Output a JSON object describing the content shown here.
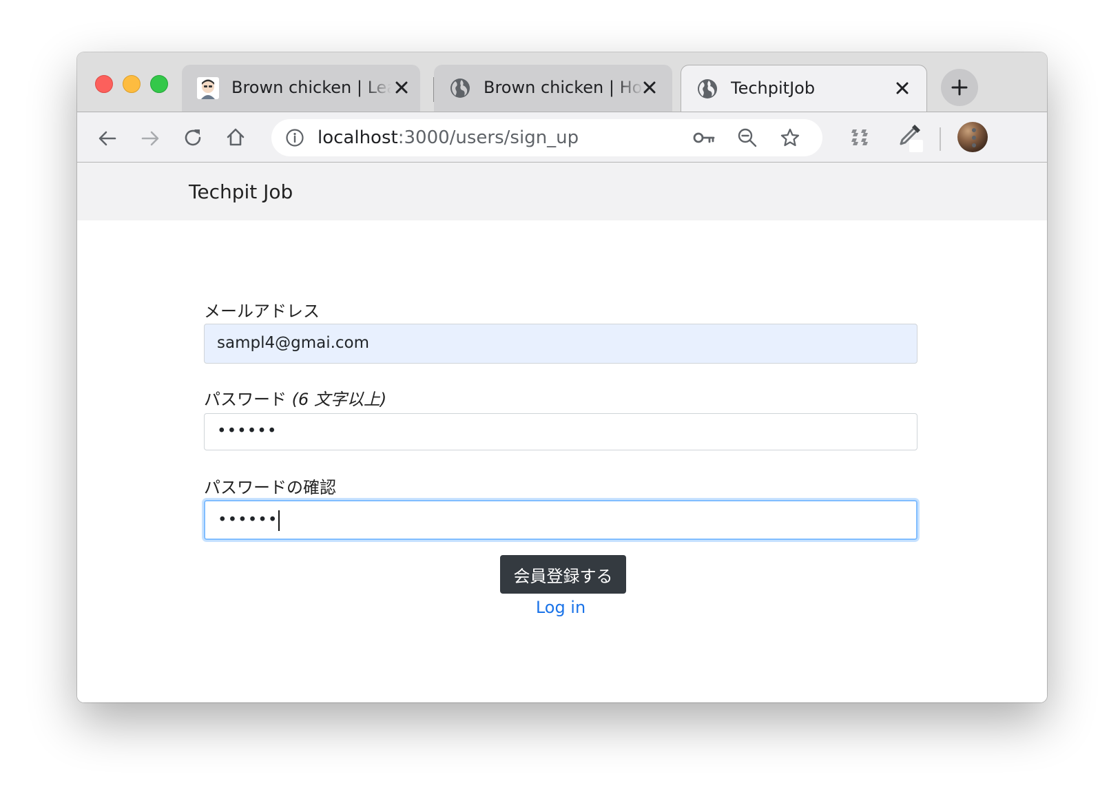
{
  "browser": {
    "tabs": [
      {
        "title": "Brown chicken | Learn",
        "favicon": "avatar-favicon-icon",
        "active": false
      },
      {
        "title": "Brown chicken | Home",
        "favicon": "globe-icon",
        "active": false
      },
      {
        "title": "TechpitJob",
        "favicon": "globe-icon",
        "active": true
      }
    ],
    "address_bar": {
      "host": "localhost",
      "path": ":3000/users/sign_up"
    },
    "toolbar_icons": [
      "back-arrow-icon",
      "forward-arrow-icon",
      "reload-icon",
      "home-icon",
      "info-icon",
      "key-icon",
      "zoom-out-icon",
      "star-icon",
      "extension-icon",
      "eyedropper-icon",
      "profile-avatar",
      "more-menu-icon"
    ]
  },
  "navbar": {
    "brand": "Techpit Job"
  },
  "form": {
    "email_label": "メールアドレス",
    "email_value": "sampl4@gmai.com",
    "password_label": "パスワード",
    "password_hint": "(6 文字以上)",
    "password_value": "••••••",
    "password_confirm_label": "パスワードの確認",
    "password_confirm_value": "••••••",
    "submit_label": "会員登録する",
    "login_link": "Log in"
  },
  "colors": {
    "autofill_bg": "#e8f0fe",
    "focus_border": "#80bdff",
    "button_bg": "#343a40",
    "link": "#1a73e8",
    "navbar_bg": "#f2f2f3"
  }
}
